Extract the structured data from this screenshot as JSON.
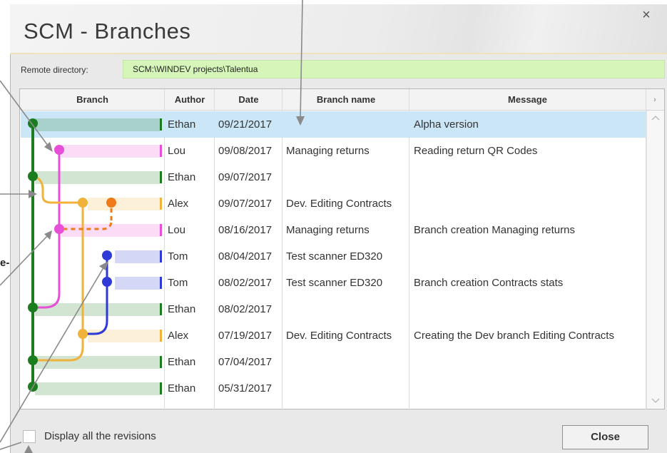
{
  "window": {
    "title": "SCM - Branches",
    "close_icon": "×"
  },
  "remote": {
    "label": "Remote directory:",
    "value": "SCM:\\WINDEV projects\\Talentua"
  },
  "table": {
    "columns": [
      "Branch",
      "Author",
      "Date",
      "Branch name",
      "Message"
    ],
    "rows": [
      {
        "author": "Ethan",
        "date": "09/21/2017",
        "branch_name": "",
        "message": "Alpha version",
        "color": "#1b7d1f",
        "selected": true
      },
      {
        "author": "Lou",
        "date": "09/08/2017",
        "branch_name": "Managing returns",
        "message": "Reading return QR Codes",
        "color": "#e84fd8"
      },
      {
        "author": "Ethan",
        "date": "09/07/2017",
        "branch_name": "",
        "message": "",
        "color": "#1b7d1f"
      },
      {
        "author": "Alex",
        "date": "09/07/2017",
        "branch_name": "Dev. Editing Contracts",
        "message": "",
        "color": "#f0b23a"
      },
      {
        "author": "Lou",
        "date": "08/16/2017",
        "branch_name": "Managing returns",
        "message": "Branch creation Managing returns",
        "color": "#e84fd8"
      },
      {
        "author": "Tom",
        "date": "08/04/2017",
        "branch_name": "Test scanner ED320",
        "message": "",
        "color": "#2e39d6"
      },
      {
        "author": "Tom",
        "date": "08/02/2017",
        "branch_name": "Test scanner ED320",
        "message": "Branch creation Contracts stats",
        "color": "#2e39d6"
      },
      {
        "author": "Ethan",
        "date": "08/02/2017",
        "branch_name": "",
        "message": "",
        "color": "#1b7d1f"
      },
      {
        "author": "Alex",
        "date": "07/19/2017",
        "branch_name": "Dev. Editing Contracts",
        "message": "Creating the Dev branch Editing Contracts",
        "color": "#f0b23a"
      },
      {
        "author": "Ethan",
        "date": "07/04/2017",
        "branch_name": "",
        "message": "",
        "color": "#1b7d1f"
      },
      {
        "author": "Ethan",
        "date": "05/31/2017",
        "branch_name": "",
        "message": "",
        "color": "#1b7d1f"
      }
    ]
  },
  "footer": {
    "checkbox_label": "Display all the revisions",
    "checkbox_checked": false,
    "close_label": "Close"
  },
  "partial_text": "e-",
  "colors": {
    "green": "#1b7d1f",
    "pink": "#e84fd8",
    "orange": "#f0b23a",
    "dark_orange": "#f07a18",
    "blue": "#2e39d6",
    "selection": "#cbe6f6",
    "remote_field": "#d6f5b9"
  }
}
